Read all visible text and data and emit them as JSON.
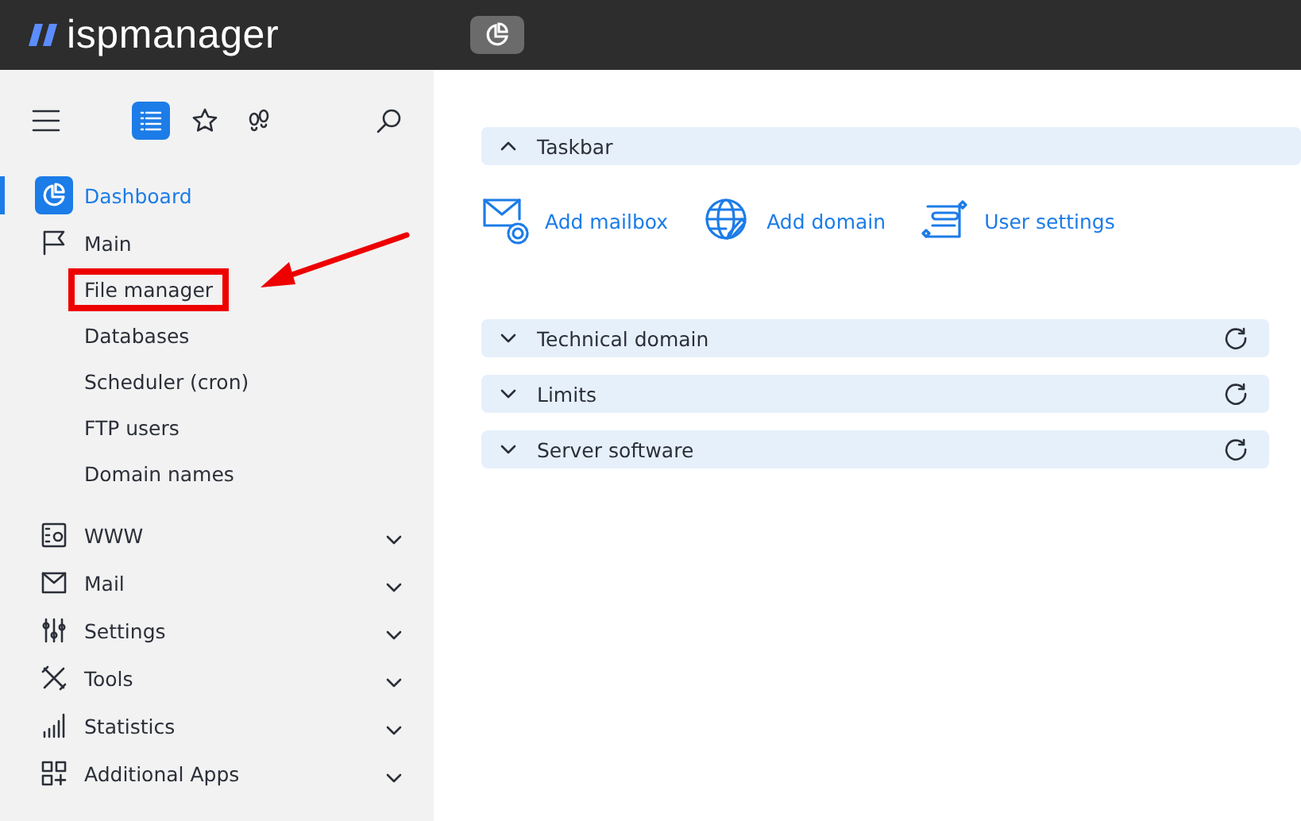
{
  "header": {
    "logo": "ispmanager",
    "dashboard_button": {
      "selected": true
    }
  },
  "sidebar": {
    "tabs": [
      {
        "kind": "list",
        "selected": true
      },
      {
        "kind": "star",
        "selected": false
      },
      {
        "kind": "steps",
        "selected": false
      }
    ],
    "items": [
      {
        "label": "Dashboard",
        "kind": "dashboard",
        "selected": true
      },
      {
        "label": "Main",
        "kind": "flag",
        "selected": false,
        "expanded": true,
        "children": [
          {
            "label": "File manager",
            "highlighted": true
          },
          {
            "label": "Databases",
            "highlighted": false
          },
          {
            "label": "Scheduler (cron)",
            "highlighted": false
          },
          {
            "label": "FTP users",
            "highlighted": false
          },
          {
            "label": "Domain names",
            "highlighted": false
          }
        ]
      },
      {
        "label": "WWW",
        "kind": "www",
        "selected": false,
        "expanded": false
      },
      {
        "label": "Mail",
        "kind": "mail",
        "selected": false,
        "expanded": false
      },
      {
        "label": "Settings",
        "kind": "sliders",
        "selected": false,
        "expanded": false
      },
      {
        "label": "Tools",
        "kind": "tools",
        "selected": false,
        "expanded": false
      },
      {
        "label": "Statistics",
        "kind": "stats",
        "selected": false,
        "expanded": false
      },
      {
        "label": "Additional Apps",
        "kind": "apps",
        "selected": false,
        "expanded": false
      }
    ]
  },
  "panels": [
    {
      "title": "Taskbar",
      "expanded": true,
      "actions": [
        {
          "label": "Add mailbox",
          "kind": "mailbox"
        },
        {
          "label": "Add domain",
          "kind": "domain"
        },
        {
          "label": "User settings",
          "kind": "user"
        }
      ]
    },
    {
      "title": "Technical domain",
      "expanded": false
    },
    {
      "title": "Limits",
      "expanded": false
    },
    {
      "title": "Server software",
      "expanded": false
    }
  ]
}
